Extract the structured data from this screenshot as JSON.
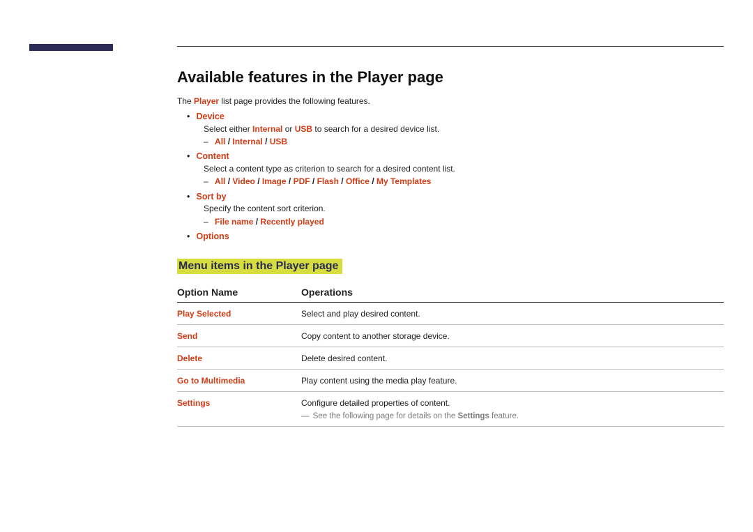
{
  "heading": "Available features in the Player page",
  "intro": {
    "pre": "The ",
    "term": "Player",
    "post": " list page provides the following features."
  },
  "features": [
    {
      "label": "Device",
      "desc": {
        "pre": "Select either ",
        "opt1": "Internal",
        "mid": " or ",
        "opt2": "USB",
        "post": " to search for a desired device list."
      },
      "sub": [
        "All",
        "Internal",
        "USB"
      ]
    },
    {
      "label": "Content",
      "desc_plain": "Select a content type as criterion to search for a desired content list.",
      "sub": [
        "All",
        "Video",
        "Image",
        "PDF",
        "Flash",
        "Office",
        "My Templates"
      ]
    },
    {
      "label": "Sort by",
      "desc_plain": "Specify the content sort criterion.",
      "sub": [
        "File name",
        "Recently played"
      ]
    },
    {
      "label": "Options"
    }
  ],
  "subheading": "Menu items in the Player page",
  "table": {
    "head": {
      "c1": "Option Name",
      "c2": "Operations"
    },
    "rows": [
      {
        "name": "Play Selected",
        "op": "Select and play desired content."
      },
      {
        "name": "Send",
        "op": "Copy content to another storage device."
      },
      {
        "name": "Delete",
        "op": "Delete desired content."
      },
      {
        "name": "Go to Multimedia",
        "op": "Play content using the media play feature."
      },
      {
        "name": "Settings",
        "op": "Configure detailed properties of content.",
        "note": {
          "pre": "See the following page for details on the ",
          "bold": "Settings",
          "post": " feature."
        }
      }
    ]
  }
}
